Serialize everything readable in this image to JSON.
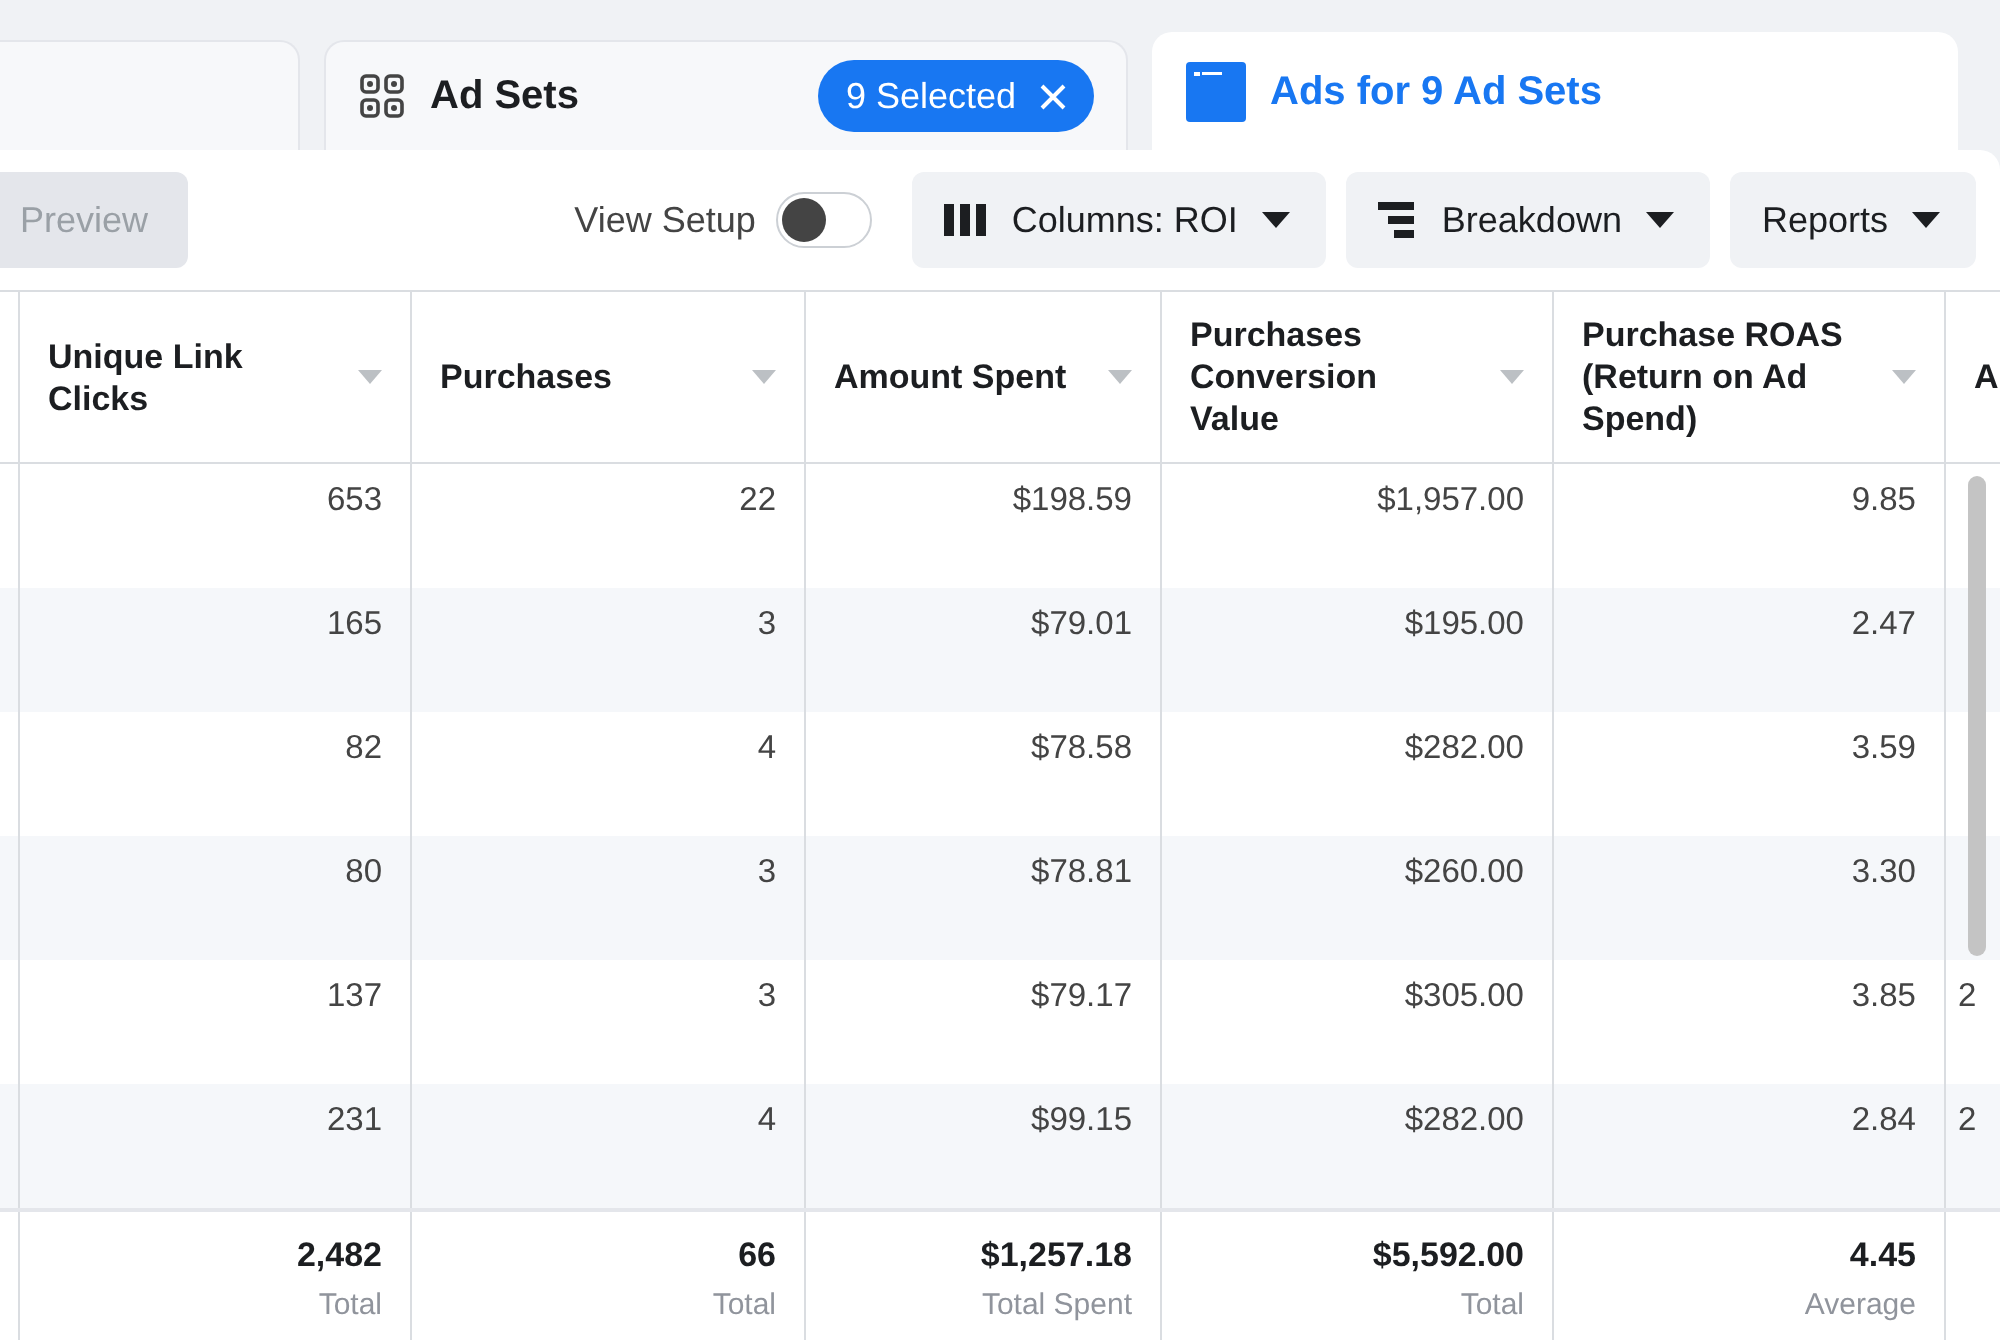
{
  "tabs": [
    {
      "selected": false
    },
    {
      "label": "Ad Sets",
      "badge": "9 Selected",
      "selected": false
    },
    {
      "label": "Ads for 9 Ad Sets",
      "selected": true
    }
  ],
  "toolbar": {
    "preview": {
      "label": "Preview",
      "disabled": true
    },
    "view_setup": {
      "label": "View Setup",
      "on": false
    },
    "buttons": [
      {
        "label": "Columns: ROI"
      },
      {
        "label": "Breakdown"
      },
      {
        "label": "Reports"
      }
    ]
  },
  "table": {
    "columns": [
      "Unique Link Clicks",
      "Purchases",
      "Amount Spent",
      "Purchases Conversion Value",
      "Purchase ROAS (Return on Ad Spend)",
      "A"
    ],
    "rows": [
      [
        "653",
        "22",
        "$198.59",
        "$1,957.00",
        "9.85"
      ],
      [
        "165",
        "3",
        "$79.01",
        "$195.00",
        "2.47"
      ],
      [
        "82",
        "4",
        "$78.58",
        "$282.00",
        "3.59"
      ],
      [
        "80",
        "3",
        "$78.81",
        "$260.00",
        "3.30"
      ],
      [
        "137",
        "3",
        "$79.17",
        "$305.00",
        "3.85",
        "2"
      ],
      [
        "231",
        "4",
        "$99.15",
        "$282.00",
        "2.84",
        "2"
      ]
    ],
    "totals": [
      {
        "value": "2,482",
        "caption": "Total"
      },
      {
        "value": "66",
        "caption": "Total"
      },
      {
        "value": "$1,257.18",
        "caption": "Total Spent"
      },
      {
        "value": "$5,592.00",
        "caption": "Total"
      },
      {
        "value": "4.45",
        "caption": "Average"
      }
    ]
  }
}
